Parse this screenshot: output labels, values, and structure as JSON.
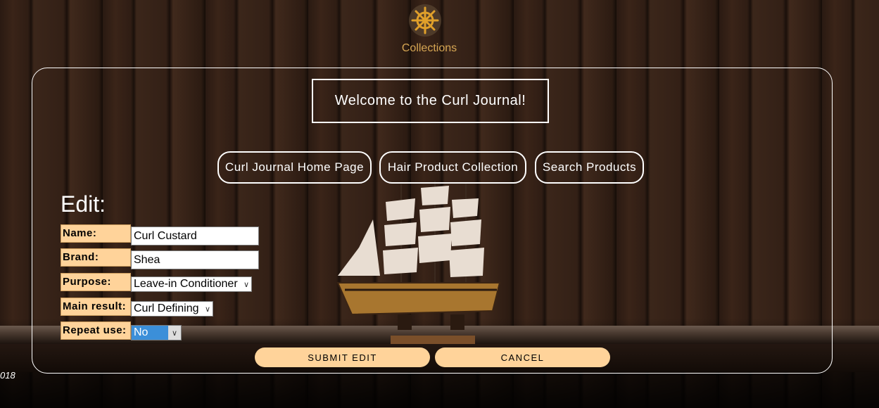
{
  "header": {
    "logo_icon": "ship-wheel-icon",
    "logo_label": "Collections"
  },
  "welcome": "Welcome to the Curl Journal!",
  "nav": [
    {
      "label": "Curl Journal Home Page"
    },
    {
      "label": "Hair Product Collection"
    },
    {
      "label": "Search Products"
    }
  ],
  "form": {
    "title": "Edit:",
    "name_label": "Name:",
    "name_value": "Curl Custard",
    "brand_label": "Brand:",
    "brand_value": "Shea",
    "purpose_label": "Purpose:",
    "purpose_value": "Leave-in Conditioner",
    "result_label": "Main result:",
    "result_value": "Curl Defining",
    "repeat_label": "Repeat use:",
    "repeat_value": "No"
  },
  "actions": {
    "submit": "SUBMIT EDIT",
    "cancel": "CANCEL"
  },
  "footer": "018",
  "colors": {
    "accent": "#d6a653",
    "label_bg": "#ffd39a",
    "highlight": "#3b8fd9"
  }
}
